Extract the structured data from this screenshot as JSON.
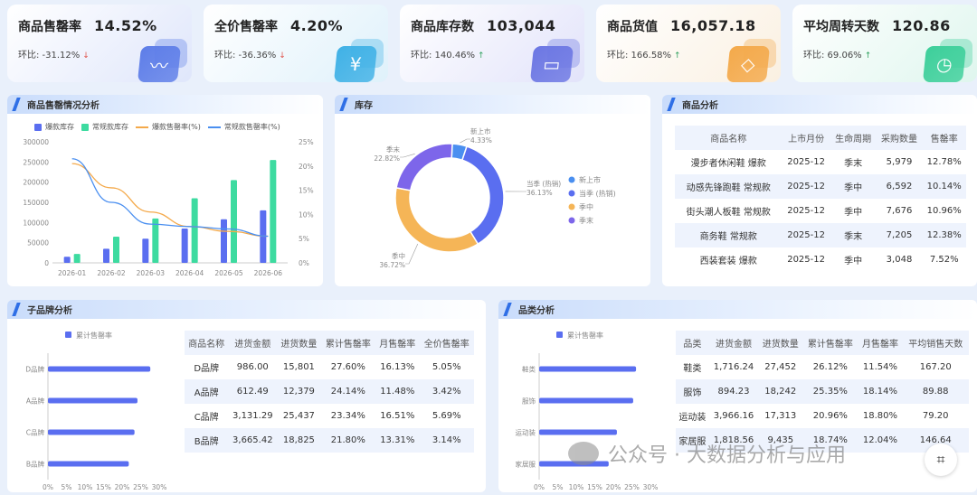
{
  "kpis": [
    {
      "title": "商品售罄率",
      "value": "14.52%",
      "change_label": "环比: -31.12%",
      "arrow": "↓",
      "arrow_color": "#e0534b",
      "icon": "pulse-icon",
      "bg": "#dfe6fb",
      "icon_color": "#5d7de8"
    },
    {
      "title": "全价售罄率",
      "value": "4.20%",
      "change_label": "环比: -36.36%",
      "arrow": "↓",
      "arrow_color": "#e0534b",
      "icon": "yen-icon",
      "bg": "#dff1fb",
      "icon_color": "#3fb1e6"
    },
    {
      "title": "商品库存数",
      "value": "103,044",
      "change_label": "环比: 140.46%",
      "arrow": "↑",
      "arrow_color": "#2ea05d",
      "icon": "box-icon",
      "bg": "#e2e3fa",
      "icon_color": "#6b76e3"
    },
    {
      "title": "商品货值",
      "value": "16,057.18",
      "change_label": "环比: 166.58%",
      "arrow": "↑",
      "arrow_color": "#2ea05d",
      "icon": "diamond-icon",
      "bg": "#faf0e1",
      "icon_color": "#f4a94a"
    },
    {
      "title": "平均周转天数",
      "value": "120.86",
      "change_label": "环比: 69.06%",
      "arrow": "↑",
      "arrow_color": "#2ea05d",
      "icon": "clock-icon",
      "bg": "#dff6ee",
      "icon_color": "#3ccf9a"
    }
  ],
  "panels": {
    "sales": "商品售罄情况分析",
    "stock": "库存",
    "product": "商品分析",
    "brand": "子品牌分析",
    "category": "品类分析"
  },
  "chart_data": [
    {
      "type": "bar",
      "id": "sales",
      "categories": [
        "2026-01",
        "2026-02",
        "2026-03",
        "2026-04",
        "2026-05",
        "2026-06"
      ],
      "series": [
        {
          "name": "爆款库存",
          "kind": "bar",
          "axis": "left",
          "color": "#5a6ef0",
          "values": [
            15000,
            35000,
            60000,
            85000,
            108000,
            130000
          ]
        },
        {
          "name": "常规款库存",
          "kind": "bar",
          "axis": "left",
          "color": "#3ddba0",
          "values": [
            22000,
            65000,
            110000,
            160000,
            205000,
            255000
          ]
        },
        {
          "name": "爆款售罄率(%)",
          "kind": "line",
          "axis": "right",
          "color": "#f4a94a",
          "values": [
            20.5,
            15.5,
            10.5,
            7.5,
            6.5,
            5.5
          ]
        },
        {
          "name": "常规款售罄率(%)",
          "kind": "line",
          "axis": "right",
          "color": "#4a8ff0",
          "values": [
            21.5,
            12.5,
            8,
            7.5,
            7,
            5.5
          ]
        }
      ],
      "ylim": [
        0,
        300000
      ],
      "y2lim": [
        0,
        25
      ],
      "yticks": [
        "0",
        "50000",
        "100000",
        "150000",
        "200000",
        "250000",
        "300000"
      ],
      "y2ticks": [
        "0%",
        "5%",
        "10%",
        "15%",
        "20%",
        "25%"
      ]
    },
    {
      "type": "pie",
      "id": "stock",
      "donut": true,
      "slices": [
        {
          "name": "新上市",
          "value": 4.33,
          "label": "新上市",
          "pct": "4.33%",
          "color": "#4a8ff0"
        },
        {
          "name": "当季 (热销)",
          "value": 36.13,
          "label": "当季 (热销)",
          "pct": "36.13%",
          "color": "#5a6ef0"
        },
        {
          "name": "季中",
          "value": 36.72,
          "label": "季中",
          "pct": "36.72%",
          "color": "#f5b557"
        },
        {
          "name": "季末",
          "value": 22.82,
          "label": "季末",
          "pct": "22.82%",
          "color": "#7d66ea"
        }
      ]
    },
    {
      "type": "bar",
      "id": "brand",
      "orientation": "horizontal",
      "legend": "累计售罄率",
      "color": "#5a6ef0",
      "categories": [
        "D品牌",
        "A品牌",
        "C品牌",
        "B品牌"
      ],
      "values": [
        27.6,
        24.14,
        23.34,
        21.8
      ],
      "xlim": [
        0,
        30
      ],
      "xticks": [
        "0%",
        "5%",
        "10%",
        "15%",
        "20%",
        "25%",
        "30%"
      ]
    },
    {
      "type": "bar",
      "id": "category",
      "orientation": "horizontal",
      "legend": "累计售罄率",
      "color": "#5a6ef0",
      "categories": [
        "鞋类",
        "服饰",
        "运动装",
        "家居服"
      ],
      "values": [
        26.12,
        25.35,
        20.96,
        18.74
      ],
      "xlim": [
        0,
        30
      ],
      "xticks": [
        "0%",
        "5%",
        "10%",
        "15%",
        "20%",
        "25%",
        "30%"
      ]
    }
  ],
  "product_table": {
    "headers": [
      "商品名称",
      "上市月份",
      "生命周期",
      "采购数量",
      "售罄率"
    ],
    "rows": [
      [
        "漫步者休闲鞋 爆款",
        "2025-12",
        "季末",
        "5,979",
        "12.78%"
      ],
      [
        "动感先锋跑鞋 常规款",
        "2025-12",
        "季中",
        "6,592",
        "10.14%"
      ],
      [
        "街头潮人板鞋 常规款",
        "2025-12",
        "季中",
        "7,676",
        "10.96%"
      ],
      [
        "商务鞋 常规款",
        "2025-12",
        "季末",
        "7,205",
        "12.38%"
      ],
      [
        "西装套装 爆款",
        "2025-12",
        "季中",
        "3,048",
        "7.52%"
      ]
    ]
  },
  "brand_table": {
    "headers": [
      "商品名称",
      "进货金额",
      "进货数量",
      "累计售罄率",
      "月售罄率",
      "全价售罄率"
    ],
    "rows": [
      [
        "D品牌",
        "986.00",
        "15,801",
        "27.60%",
        "16.13%",
        "5.05%"
      ],
      [
        "A品牌",
        "612.49",
        "12,379",
        "24.14%",
        "11.48%",
        "3.42%"
      ],
      [
        "C品牌",
        "3,131.29",
        "25,437",
        "23.34%",
        "16.51%",
        "5.69%"
      ],
      [
        "B品牌",
        "3,665.42",
        "18,825",
        "21.80%",
        "13.31%",
        "3.14%"
      ]
    ]
  },
  "category_table": {
    "headers": [
      "品类",
      "进货金额",
      "进货数量",
      "累计售罄率",
      "月售罄率",
      "平均销售天数"
    ],
    "rows": [
      [
        "鞋类",
        "1,716.24",
        "27,452",
        "26.12%",
        "11.54%",
        "167.20"
      ],
      [
        "服饰",
        "894.23",
        "18,242",
        "25.35%",
        "18.14%",
        "89.88"
      ],
      [
        "运动装",
        "3,966.16",
        "17,313",
        "20.96%",
        "18.80%",
        "79.20"
      ],
      [
        "家居服",
        "1,818.56",
        "9,435",
        "18.74%",
        "12.04%",
        "146.64"
      ]
    ]
  },
  "watermark": "公众号 · 大数据分析与应用"
}
